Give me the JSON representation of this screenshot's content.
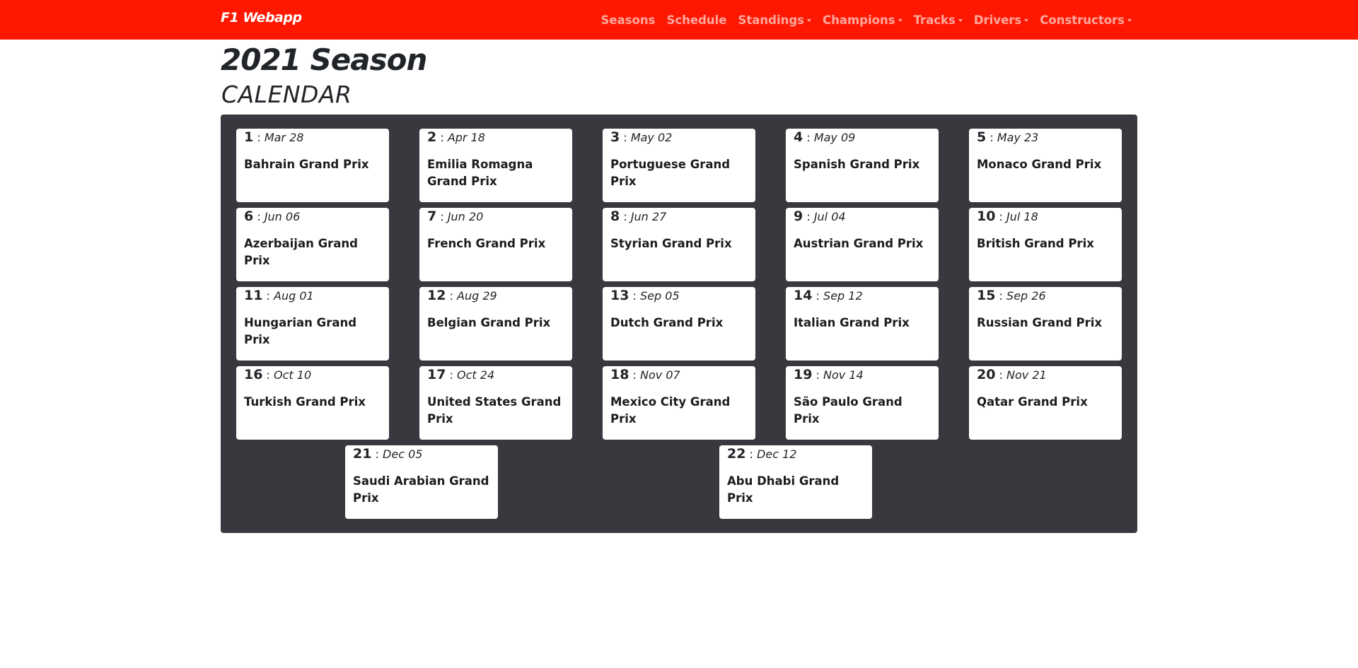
{
  "navbar": {
    "brand": "F1 Webapp",
    "links": [
      {
        "label": "Seasons",
        "dropdown": false
      },
      {
        "label": "Schedule",
        "dropdown": false
      },
      {
        "label": "Standings",
        "dropdown": true
      },
      {
        "label": "Champions",
        "dropdown": true
      },
      {
        "label": "Tracks",
        "dropdown": true
      },
      {
        "label": "Drivers",
        "dropdown": true
      },
      {
        "label": "Constructors",
        "dropdown": true
      }
    ]
  },
  "page": {
    "title": "2021 Season",
    "subtitle": "CALENDAR",
    "separator": ":"
  },
  "colors": {
    "navbar": "#ff1801",
    "panel": "#38393e",
    "card": "#ffffff"
  },
  "races": [
    {
      "round": "1",
      "date": "Mar 28",
      "name": "Bahrain Grand Prix"
    },
    {
      "round": "2",
      "date": "Apr 18",
      "name": "Emilia Romagna Grand Prix"
    },
    {
      "round": "3",
      "date": "May 02",
      "name": "Portuguese Grand Prix"
    },
    {
      "round": "4",
      "date": "May 09",
      "name": "Spanish Grand Prix"
    },
    {
      "round": "5",
      "date": "May 23",
      "name": "Monaco Grand Prix"
    },
    {
      "round": "6",
      "date": "Jun 06",
      "name": "Azerbaijan Grand Prix"
    },
    {
      "round": "7",
      "date": "Jun 20",
      "name": "French Grand Prix"
    },
    {
      "round": "8",
      "date": "Jun 27",
      "name": "Styrian Grand Prix"
    },
    {
      "round": "9",
      "date": "Jul 04",
      "name": "Austrian Grand Prix"
    },
    {
      "round": "10",
      "date": "Jul 18",
      "name": "British Grand Prix"
    },
    {
      "round": "11",
      "date": "Aug 01",
      "name": "Hungarian Grand Prix"
    },
    {
      "round": "12",
      "date": "Aug 29",
      "name": "Belgian Grand Prix"
    },
    {
      "round": "13",
      "date": "Sep 05",
      "name": "Dutch Grand Prix"
    },
    {
      "round": "14",
      "date": "Sep 12",
      "name": "Italian Grand Prix"
    },
    {
      "round": "15",
      "date": "Sep 26",
      "name": "Russian Grand Prix"
    },
    {
      "round": "16",
      "date": "Oct 10",
      "name": "Turkish Grand Prix"
    },
    {
      "round": "17",
      "date": "Oct 24",
      "name": "United States Grand Prix"
    },
    {
      "round": "18",
      "date": "Nov 07",
      "name": "Mexico City Grand Prix"
    },
    {
      "round": "19",
      "date": "Nov 14",
      "name": "São Paulo Grand Prix"
    },
    {
      "round": "20",
      "date": "Nov 21",
      "name": "Qatar Grand Prix"
    },
    {
      "round": "21",
      "date": "Dec 05",
      "name": "Saudi Arabian Grand Prix"
    },
    {
      "round": "22",
      "date": "Dec 12",
      "name": "Abu Dhabi Grand Prix"
    }
  ]
}
